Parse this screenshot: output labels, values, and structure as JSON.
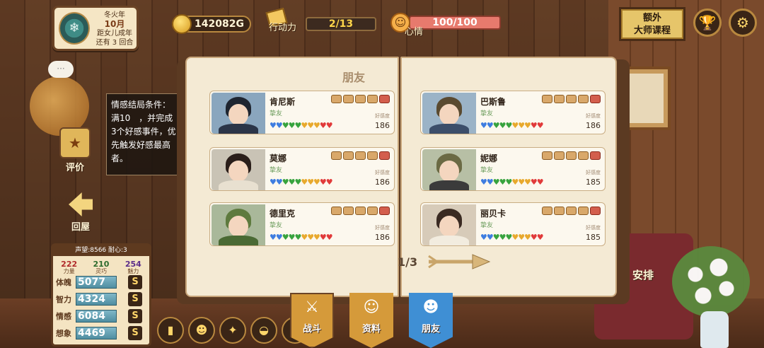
{
  "header": {
    "date": {
      "season": "冬火年",
      "month": "10月",
      "line1": "距女儿成年",
      "line2": "还有 3 回合"
    },
    "gold": "142082G",
    "action": {
      "label": "行动力",
      "value": "2/13"
    },
    "mood": {
      "label": "心情",
      "value": "100/100"
    },
    "extra_course": {
      "line1": "额外",
      "line2": "大师课程"
    }
  },
  "left": {
    "tip": "情感结局条件：满10　，并完成3个好感事件，优先触发好感最高者。",
    "rate_label": "评价",
    "home_label": "回屋",
    "bubble": "···"
  },
  "stats": {
    "header": "声望:8566   耐心:3",
    "triple": [
      {
        "value": "222",
        "label": "力量"
      },
      {
        "value": "210",
        "label": "灵巧"
      },
      {
        "value": "254",
        "label": "魅力"
      }
    ],
    "rows": [
      {
        "name": "体魄",
        "value": "5077",
        "rank": "S"
      },
      {
        "name": "智力",
        "value": "4324",
        "rank": "S"
      },
      {
        "name": "情感",
        "value": "6084",
        "rank": "S"
      },
      {
        "name": "想象",
        "value": "4469",
        "rank": "S"
      }
    ]
  },
  "book": {
    "title": "朋友",
    "pager": "1/3",
    "fav_label": "好感度",
    "friends": [
      {
        "name": "肯尼斯",
        "tag": "挚友",
        "score": "186",
        "hearts": 10
      },
      {
        "name": "巴斯鲁",
        "tag": "挚友",
        "score": "186",
        "hearts": 10
      },
      {
        "name": "莫娜",
        "tag": "挚友",
        "score": "186",
        "hearts": 10
      },
      {
        "name": "妮娜",
        "tag": "挚友",
        "score": "185",
        "hearts": 10
      },
      {
        "name": "德里克",
        "tag": "挚友",
        "score": "186",
        "hearts": 10
      },
      {
        "name": "丽贝卡",
        "tag": "挚友",
        "score": "185",
        "hearts": 10
      }
    ]
  },
  "tabs": [
    {
      "label": "战斗",
      "icon": "swords-icon",
      "color": "#d59a3a"
    },
    {
      "label": "资料",
      "icon": "face-icon",
      "color": "#d59a3a"
    },
    {
      "label": "朋友",
      "icon": "friend-icon",
      "color": "#3f8fd4"
    }
  ],
  "right": {
    "arrange_label": "安排"
  }
}
